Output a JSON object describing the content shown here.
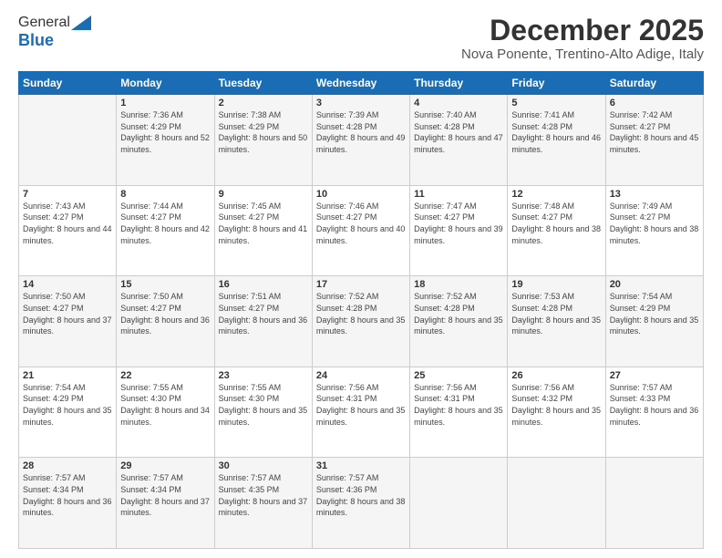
{
  "header": {
    "logo_general": "General",
    "logo_blue": "Blue",
    "title": "December 2025",
    "subtitle": "Nova Ponente, Trentino-Alto Adige, Italy"
  },
  "days_of_week": [
    "Sunday",
    "Monday",
    "Tuesday",
    "Wednesday",
    "Thursday",
    "Friday",
    "Saturday"
  ],
  "weeks": [
    [
      {
        "day": "",
        "sunrise": "",
        "sunset": "",
        "daylight": ""
      },
      {
        "day": "1",
        "sunrise": "Sunrise: 7:36 AM",
        "sunset": "Sunset: 4:29 PM",
        "daylight": "Daylight: 8 hours and 52 minutes."
      },
      {
        "day": "2",
        "sunrise": "Sunrise: 7:38 AM",
        "sunset": "Sunset: 4:29 PM",
        "daylight": "Daylight: 8 hours and 50 minutes."
      },
      {
        "day": "3",
        "sunrise": "Sunrise: 7:39 AM",
        "sunset": "Sunset: 4:28 PM",
        "daylight": "Daylight: 8 hours and 49 minutes."
      },
      {
        "day": "4",
        "sunrise": "Sunrise: 7:40 AM",
        "sunset": "Sunset: 4:28 PM",
        "daylight": "Daylight: 8 hours and 47 minutes."
      },
      {
        "day": "5",
        "sunrise": "Sunrise: 7:41 AM",
        "sunset": "Sunset: 4:28 PM",
        "daylight": "Daylight: 8 hours and 46 minutes."
      },
      {
        "day": "6",
        "sunrise": "Sunrise: 7:42 AM",
        "sunset": "Sunset: 4:27 PM",
        "daylight": "Daylight: 8 hours and 45 minutes."
      }
    ],
    [
      {
        "day": "7",
        "sunrise": "Sunrise: 7:43 AM",
        "sunset": "Sunset: 4:27 PM",
        "daylight": "Daylight: 8 hours and 44 minutes."
      },
      {
        "day": "8",
        "sunrise": "Sunrise: 7:44 AM",
        "sunset": "Sunset: 4:27 PM",
        "daylight": "Daylight: 8 hours and 42 minutes."
      },
      {
        "day": "9",
        "sunrise": "Sunrise: 7:45 AM",
        "sunset": "Sunset: 4:27 PM",
        "daylight": "Daylight: 8 hours and 41 minutes."
      },
      {
        "day": "10",
        "sunrise": "Sunrise: 7:46 AM",
        "sunset": "Sunset: 4:27 PM",
        "daylight": "Daylight: 8 hours and 40 minutes."
      },
      {
        "day": "11",
        "sunrise": "Sunrise: 7:47 AM",
        "sunset": "Sunset: 4:27 PM",
        "daylight": "Daylight: 8 hours and 39 minutes."
      },
      {
        "day": "12",
        "sunrise": "Sunrise: 7:48 AM",
        "sunset": "Sunset: 4:27 PM",
        "daylight": "Daylight: 8 hours and 38 minutes."
      },
      {
        "day": "13",
        "sunrise": "Sunrise: 7:49 AM",
        "sunset": "Sunset: 4:27 PM",
        "daylight": "Daylight: 8 hours and 38 minutes."
      }
    ],
    [
      {
        "day": "14",
        "sunrise": "Sunrise: 7:50 AM",
        "sunset": "Sunset: 4:27 PM",
        "daylight": "Daylight: 8 hours and 37 minutes."
      },
      {
        "day": "15",
        "sunrise": "Sunrise: 7:50 AM",
        "sunset": "Sunset: 4:27 PM",
        "daylight": "Daylight: 8 hours and 36 minutes."
      },
      {
        "day": "16",
        "sunrise": "Sunrise: 7:51 AM",
        "sunset": "Sunset: 4:27 PM",
        "daylight": "Daylight: 8 hours and 36 minutes."
      },
      {
        "day": "17",
        "sunrise": "Sunrise: 7:52 AM",
        "sunset": "Sunset: 4:28 PM",
        "daylight": "Daylight: 8 hours and 35 minutes."
      },
      {
        "day": "18",
        "sunrise": "Sunrise: 7:52 AM",
        "sunset": "Sunset: 4:28 PM",
        "daylight": "Daylight: 8 hours and 35 minutes."
      },
      {
        "day": "19",
        "sunrise": "Sunrise: 7:53 AM",
        "sunset": "Sunset: 4:28 PM",
        "daylight": "Daylight: 8 hours and 35 minutes."
      },
      {
        "day": "20",
        "sunrise": "Sunrise: 7:54 AM",
        "sunset": "Sunset: 4:29 PM",
        "daylight": "Daylight: 8 hours and 35 minutes."
      }
    ],
    [
      {
        "day": "21",
        "sunrise": "Sunrise: 7:54 AM",
        "sunset": "Sunset: 4:29 PM",
        "daylight": "Daylight: 8 hours and 35 minutes."
      },
      {
        "day": "22",
        "sunrise": "Sunrise: 7:55 AM",
        "sunset": "Sunset: 4:30 PM",
        "daylight": "Daylight: 8 hours and 34 minutes."
      },
      {
        "day": "23",
        "sunrise": "Sunrise: 7:55 AM",
        "sunset": "Sunset: 4:30 PM",
        "daylight": "Daylight: 8 hours and 35 minutes."
      },
      {
        "day": "24",
        "sunrise": "Sunrise: 7:56 AM",
        "sunset": "Sunset: 4:31 PM",
        "daylight": "Daylight: 8 hours and 35 minutes."
      },
      {
        "day": "25",
        "sunrise": "Sunrise: 7:56 AM",
        "sunset": "Sunset: 4:31 PM",
        "daylight": "Daylight: 8 hours and 35 minutes."
      },
      {
        "day": "26",
        "sunrise": "Sunrise: 7:56 AM",
        "sunset": "Sunset: 4:32 PM",
        "daylight": "Daylight: 8 hours and 35 minutes."
      },
      {
        "day": "27",
        "sunrise": "Sunrise: 7:57 AM",
        "sunset": "Sunset: 4:33 PM",
        "daylight": "Daylight: 8 hours and 36 minutes."
      }
    ],
    [
      {
        "day": "28",
        "sunrise": "Sunrise: 7:57 AM",
        "sunset": "Sunset: 4:34 PM",
        "daylight": "Daylight: 8 hours and 36 minutes."
      },
      {
        "day": "29",
        "sunrise": "Sunrise: 7:57 AM",
        "sunset": "Sunset: 4:34 PM",
        "daylight": "Daylight: 8 hours and 37 minutes."
      },
      {
        "day": "30",
        "sunrise": "Sunrise: 7:57 AM",
        "sunset": "Sunset: 4:35 PM",
        "daylight": "Daylight: 8 hours and 37 minutes."
      },
      {
        "day": "31",
        "sunrise": "Sunrise: 7:57 AM",
        "sunset": "Sunset: 4:36 PM",
        "daylight": "Daylight: 8 hours and 38 minutes."
      },
      {
        "day": "",
        "sunrise": "",
        "sunset": "",
        "daylight": ""
      },
      {
        "day": "",
        "sunrise": "",
        "sunset": "",
        "daylight": ""
      },
      {
        "day": "",
        "sunrise": "",
        "sunset": "",
        "daylight": ""
      }
    ]
  ]
}
